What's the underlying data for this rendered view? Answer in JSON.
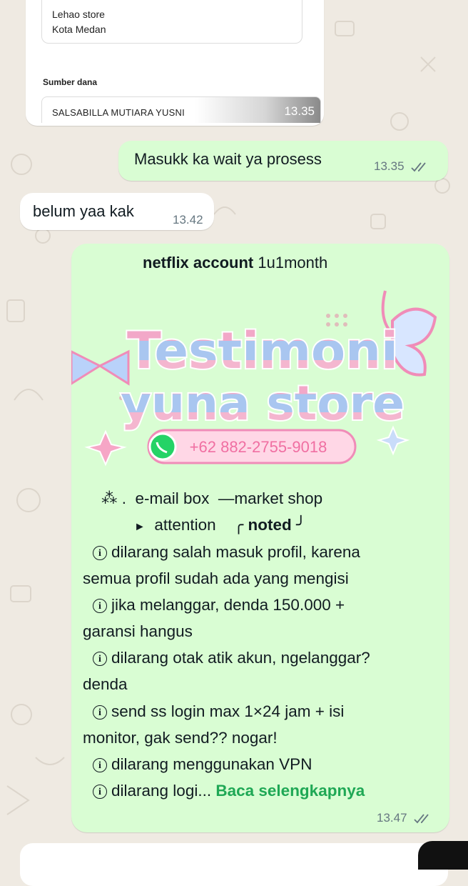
{
  "quoted_card": {
    "address_lines": [
      "Lehao store",
      "Kota Medan"
    ],
    "section_label": "Sumber dana",
    "account_name": "SALSABILLA MUTIARA YUSNI",
    "time": "13.35"
  },
  "messages": [
    {
      "direction": "out",
      "text": "Masukk ka wait ya prosess",
      "time": "13.35",
      "status": "read"
    },
    {
      "direction": "in",
      "text": "belum yaa kak",
      "time": "13.42"
    }
  ],
  "testimoni": {
    "title_bold": "netflix account",
    "title_rest": " 1u1month",
    "banner_line1": "Testimoni",
    "banner_line2": "yuna store",
    "phone": "+62 882-2755-9018",
    "bullet_mark": "⁂ .",
    "row1_a": "e-mail box",
    "row1_b": "—market shop",
    "row2_arrow": "►",
    "row2_a": "attention",
    "row2_open": "╭",
    "row2_b": "noted",
    "row2_close": "╯",
    "info_symbol": "i",
    "rules": [
      "dilarang salah masuk profil, karena",
      "semua profil sudah ada yang mengisi",
      "jika melanggar, denda 150.000 +",
      "garansi hangus",
      "dilarang otak atik akun, ngelanggar?",
      "denda",
      "send ss login max 1×24 jam + isi",
      "monitor, gak send?? nogar!",
      "dilarang menggunakan VPN",
      "dilarang logi..."
    ],
    "read_more": "Baca selengkapnya",
    "time": "13.47",
    "status": "read"
  },
  "colors": {
    "chat_bg": "#efeae2",
    "outgoing": "#d9fdd3",
    "incoming": "#ffffff",
    "link_green": "#1fa855",
    "tick": "#667781"
  }
}
